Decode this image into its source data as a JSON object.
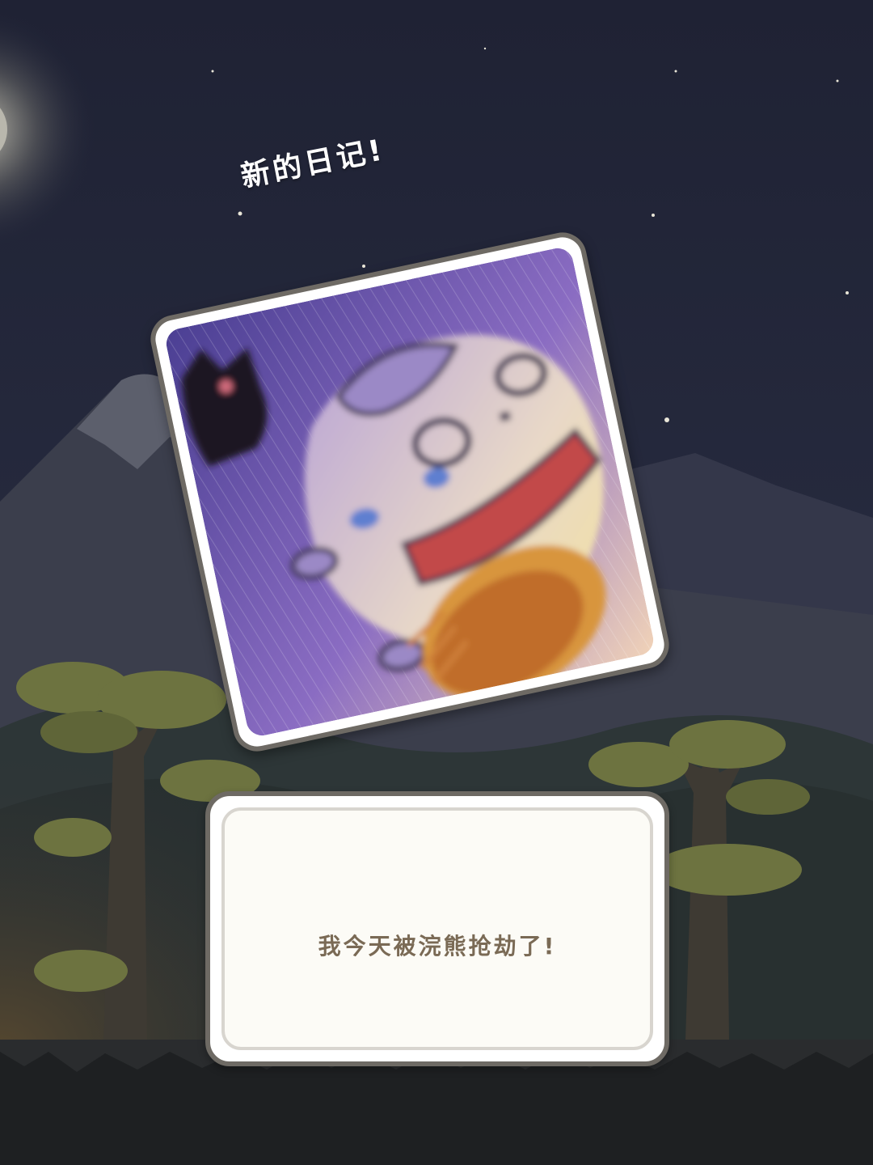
{
  "popup": {
    "title": "新的日记!",
    "diary_text": "我今天被浣熊抢劫了!"
  },
  "icons": {
    "moon": "moon-icon",
    "stars": "star-icon",
    "diary_photo": "diary-photo"
  },
  "colors": {
    "sky": "#23263a",
    "card_border": "#6e6a64",
    "card_fill": "#fcfbf6",
    "diary_text": "#7a6a55"
  }
}
